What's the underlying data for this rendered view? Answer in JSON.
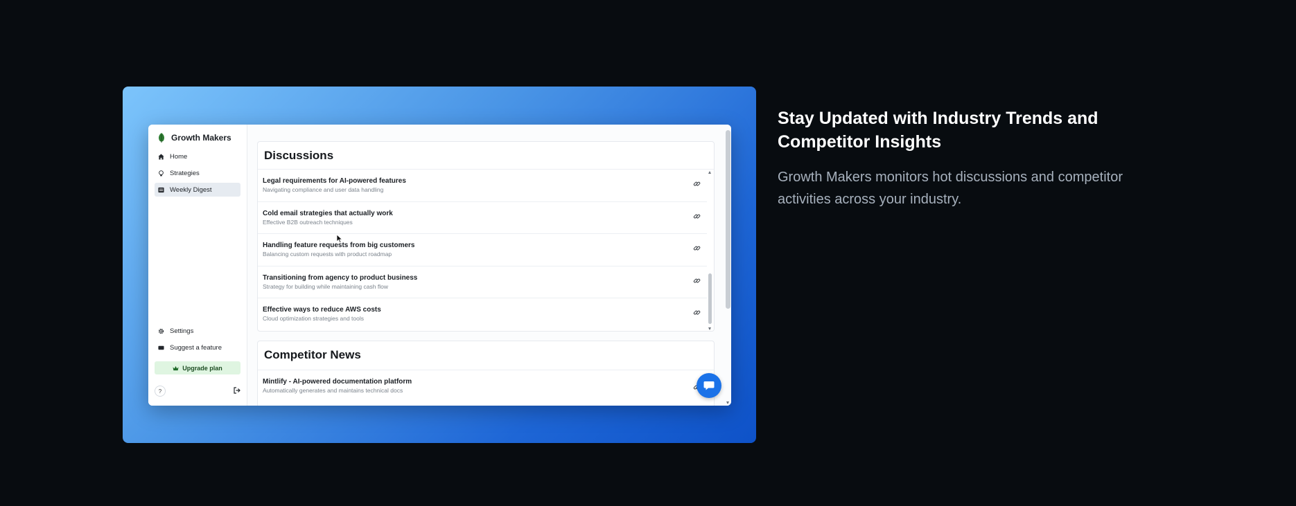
{
  "app": {
    "brand_name": "Growth Makers",
    "nav": [
      {
        "label": "Home",
        "icon": "home-icon"
      },
      {
        "label": "Strategies",
        "icon": "lightbulb-icon"
      },
      {
        "label": "Weekly Digest",
        "icon": "newspaper-icon",
        "active": true
      }
    ],
    "bottom_nav": [
      {
        "label": "Settings",
        "icon": "gear-icon"
      },
      {
        "label": "Suggest a feature",
        "icon": "message-icon"
      }
    ],
    "upgrade_label": "Upgrade plan",
    "help_label": "?"
  },
  "discussions": {
    "title": "Discussions",
    "items": [
      {
        "title": "Legal requirements for AI-powered features",
        "subtitle": "Navigating compliance and user data handling"
      },
      {
        "title": "Cold email strategies that actually work",
        "subtitle": "Effective B2B outreach techniques"
      },
      {
        "title": "Handling feature requests from big customers",
        "subtitle": "Balancing custom requests with product roadmap"
      },
      {
        "title": "Transitioning from agency to product business",
        "subtitle": "Strategy for building while maintaining cash flow"
      },
      {
        "title": "Effective ways to reduce AWS costs",
        "subtitle": "Cloud optimization strategies and tools"
      }
    ]
  },
  "competitor_news": {
    "title": "Competitor News",
    "items": [
      {
        "title": "Mintlify - AI-powered documentation platform",
        "subtitle": "Automatically generates and maintains technical docs"
      }
    ]
  },
  "copy": {
    "heading": "Stay Updated with Industry Trends and Competitor Insights",
    "body": "Growth Makers monitors hot discussions and competitor activities across your industry."
  },
  "colors": {
    "page_bg": "#080c10",
    "accent_blue": "#1b72e8",
    "upgrade_bg": "#dff5e1"
  }
}
